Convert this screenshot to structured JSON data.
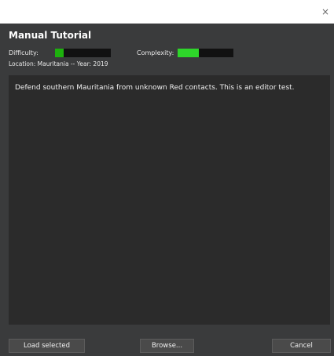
{
  "window": {
    "close_glyph": "×"
  },
  "scenario": {
    "title": "Manual Tutorial",
    "difficulty_label": "Difficulty:",
    "difficulty_level": 0.15,
    "complexity_label": "Complexity:",
    "complexity_level": 0.38,
    "location_line": "Location: Mauritania  --  Year: 2019",
    "description": "Defend southern Mauritania from unknown Red contacts. This is an editor test."
  },
  "buttons": {
    "load_selected": "Load selected",
    "browse": "Browse...",
    "cancel": "Cancel"
  },
  "colors": {
    "difficulty_fill": "#1db10d",
    "complexity_fill": "#2ed62a",
    "panel_bg": "#3a3b3c",
    "desc_bg": "#2b2b2b"
  }
}
